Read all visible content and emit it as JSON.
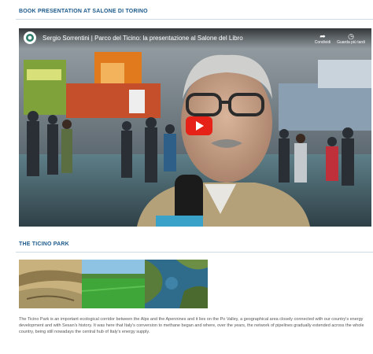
{
  "sections": {
    "book": {
      "title": "BOOK PRESENTATION AT SALONE DI TORINO"
    },
    "park": {
      "title": "THE TICINO PARK"
    }
  },
  "video": {
    "title": "Sergio Sorrentini | Parco del Ticino: la presentazione al Salone del Libro",
    "share_label": "Condividi",
    "watch_later_label": "Guarda più tardi",
    "play_icon": "play-icon",
    "accent_color": "#e62117"
  },
  "gallery": {
    "images": [
      "river-sand-photo",
      "green-field-photo",
      "wetland-photo"
    ]
  },
  "description": "The Ticino Park is an important ecological corridor between the Alps and the Apennines and it lies on the Po Valley, a geographical area closely connected with our country's energy development and with Sesan's history. It was here that Italy's conversion to methane began and where, over the years, the network of pipelines gradually extended across the whole country, being still nowadays the central hub of Italy's energy supply."
}
